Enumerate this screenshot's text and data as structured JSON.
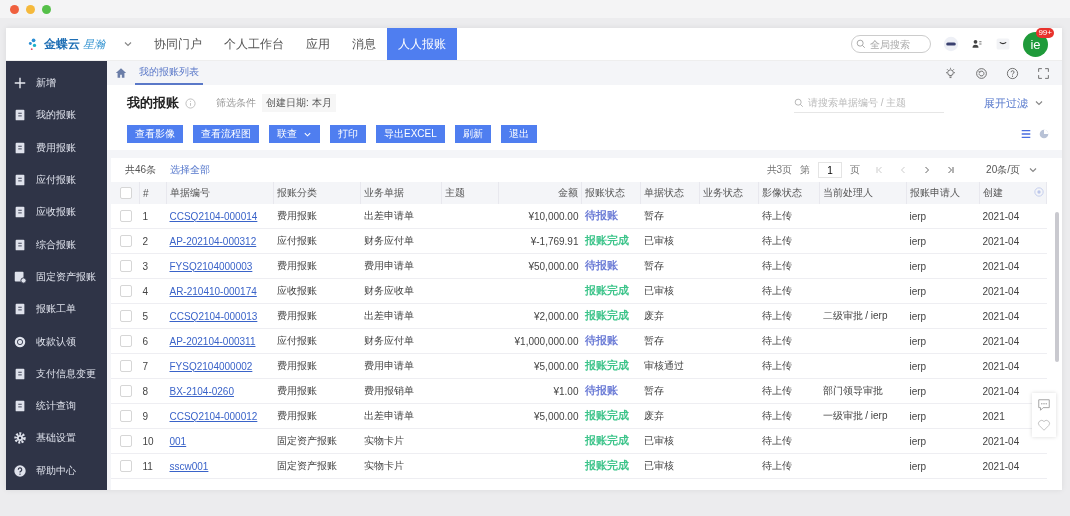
{
  "logo": {
    "brand": "金蝶云",
    "product": "星瀚"
  },
  "nav_tabs": [
    {
      "label": "协同门户",
      "selected": false
    },
    {
      "label": "个人工作台",
      "selected": false
    },
    {
      "label": "应用",
      "selected": false
    },
    {
      "label": "消息",
      "selected": false
    },
    {
      "label": "人人报账",
      "selected": true
    }
  ],
  "global_search": {
    "placeholder": "全局搜索"
  },
  "avatar": {
    "initials": "ie",
    "badge": "99+"
  },
  "sidebar": {
    "items": [
      {
        "label": "新增",
        "kind": "add"
      },
      {
        "label": "我的报账",
        "kind": "doc"
      },
      {
        "label": "费用报账",
        "kind": "doc"
      },
      {
        "label": "应付报账",
        "kind": "doc"
      },
      {
        "label": "应收报账",
        "kind": "doc"
      },
      {
        "label": "综合报账",
        "kind": "doc"
      },
      {
        "label": "固定资产报账",
        "kind": "stack"
      },
      {
        "label": "报账工单",
        "kind": "doc"
      },
      {
        "label": "收款认领",
        "kind": "coin"
      },
      {
        "label": "支付信息变更",
        "kind": "doc"
      },
      {
        "label": "统计查询",
        "kind": "doc"
      },
      {
        "label": "基础设置",
        "kind": "gear"
      },
      {
        "label": "帮助中心",
        "kind": "help"
      }
    ]
  },
  "page_tabs": [
    {
      "label": "我的报账列表",
      "selected": true
    }
  ],
  "page": {
    "title": "我的报账",
    "filter_label": "筛选条件",
    "filter_chip": "创建日期: 本月",
    "search_placeholder": "请搜索单据编号 / 主题",
    "expand_filter": "展开过滤"
  },
  "toolbar": [
    {
      "label": "查看影像",
      "kind": "plain"
    },
    {
      "label": "查看流程图",
      "kind": "plain"
    },
    {
      "label": "联查",
      "kind": "dropdown"
    },
    {
      "label": "打印",
      "kind": "plain"
    },
    {
      "label": "导出EXCEL",
      "kind": "plain"
    },
    {
      "label": "刷新",
      "kind": "plain"
    },
    {
      "label": "退出",
      "kind": "plain"
    }
  ],
  "table": {
    "select_all_checked": false,
    "total": "共46条",
    "select_all": "选择全部",
    "pager": {
      "pages": "共3页",
      "page_prefix": "第",
      "page": "1",
      "page_suffix": "页",
      "page_size": "20条/页"
    },
    "columns": [
      "#",
      "单据编号",
      "报账分类",
      "业务单据",
      "主题",
      "金额",
      "报账状态",
      "单据状态",
      "业务状态",
      "影像状态",
      "当前处理人",
      "报账申请人",
      "创建"
    ],
    "rows": [
      {
        "checked": false,
        "no": "1",
        "code": "CCSQ2104-000014",
        "category": "费用报账",
        "document": "出差申请单",
        "amount": "¥10,000.00",
        "status": {
          "text": "待报账",
          "color": "#6b7bd6"
        },
        "doc_status": "暂存",
        "image_status": "待上传",
        "applicant": "ierp",
        "created": "2021-04"
      },
      {
        "checked": false,
        "no": "2",
        "code": "AP-202104-000312",
        "category": "应付报账",
        "document": "财务应付单",
        "amount": "¥-1,769.91",
        "status": {
          "text": "报账完成",
          "color": "#3cc48a"
        },
        "doc_status": "已审核",
        "image_status": "待上传",
        "applicant": "ierp",
        "created": "2021-04"
      },
      {
        "checked": false,
        "no": "3",
        "code": "FYSQ2104000003",
        "category": "费用报账",
        "document": "费用申请单",
        "amount": "¥50,000.00",
        "status": {
          "text": "待报账",
          "color": "#6b7bd6"
        },
        "doc_status": "暂存",
        "image_status": "待上传",
        "applicant": "ierp",
        "created": "2021-04"
      },
      {
        "checked": false,
        "no": "4",
        "code": "AR-210410-000174",
        "category": "应收报账",
        "document": "财务应收单",
        "status": {
          "text": "报账完成",
          "color": "#3cc48a"
        },
        "doc_status": "已审核",
        "image_status": "待上传",
        "applicant": "ierp",
        "created": "2021-04"
      },
      {
        "checked": false,
        "no": "5",
        "code": "CCSQ2104-000013",
        "category": "费用报账",
        "document": "出差申请单",
        "amount": "¥2,000.00",
        "status": {
          "text": "报账完成",
          "color": "#3cc48a"
        },
        "doc_status": "废弃",
        "image_status": "待上传",
        "handler": "二级审批 / ierp",
        "applicant": "ierp",
        "created": "2021-04"
      },
      {
        "checked": false,
        "no": "6",
        "code": "AP-202104-000311",
        "category": "应付报账",
        "document": "财务应付单",
        "amount": "¥1,000,000.00",
        "status": {
          "text": "待报账",
          "color": "#6b7bd6"
        },
        "doc_status": "暂存",
        "image_status": "待上传",
        "applicant": "ierp",
        "created": "2021-04"
      },
      {
        "checked": false,
        "no": "7",
        "code": "FYSQ2104000002",
        "category": "费用报账",
        "document": "费用申请单",
        "amount": "¥5,000.00",
        "status": {
          "text": "报账完成",
          "color": "#3cc48a"
        },
        "doc_status": "审核通过",
        "image_status": "待上传",
        "applicant": "ierp",
        "created": "2021-04"
      },
      {
        "checked": false,
        "no": "8",
        "code": "BX-2104-0260",
        "category": "费用报账",
        "document": "费用报销单",
        "amount": "¥1.00",
        "status": {
          "text": "待报账",
          "color": "#6b7bd6"
        },
        "doc_status": "暂存",
        "image_status": "待上传",
        "handler": "部门领导审批",
        "applicant": "ierp",
        "created": "2021-04"
      },
      {
        "checked": false,
        "no": "9",
        "code": "CCSQ2104-000012",
        "category": "费用报账",
        "document": "出差申请单",
        "amount": "¥5,000.00",
        "status": {
          "text": "报账完成",
          "color": "#3cc48a"
        },
        "doc_status": "废弃",
        "image_status": "待上传",
        "handler": "一级审批 / ierp",
        "applicant": "ierp",
        "created": "2021"
      },
      {
        "checked": false,
        "no": "10",
        "code": "001",
        "category": "固定资产报账",
        "document": "实物卡片",
        "status": {
          "text": "报账完成",
          "color": "#3cc48a"
        },
        "doc_status": "已审核",
        "image_status": "待上传",
        "applicant": "ierp",
        "created": "2021-04"
      },
      {
        "checked": false,
        "no": "11",
        "code": "sscw001",
        "category": "固定资产报账",
        "document": "实物卡片",
        "status": {
          "text": "报账完成",
          "color": "#3cc48a"
        },
        "doc_status": "已审核",
        "image_status": "待上传",
        "applicant": "ierp",
        "created": "2021-04"
      }
    ]
  }
}
